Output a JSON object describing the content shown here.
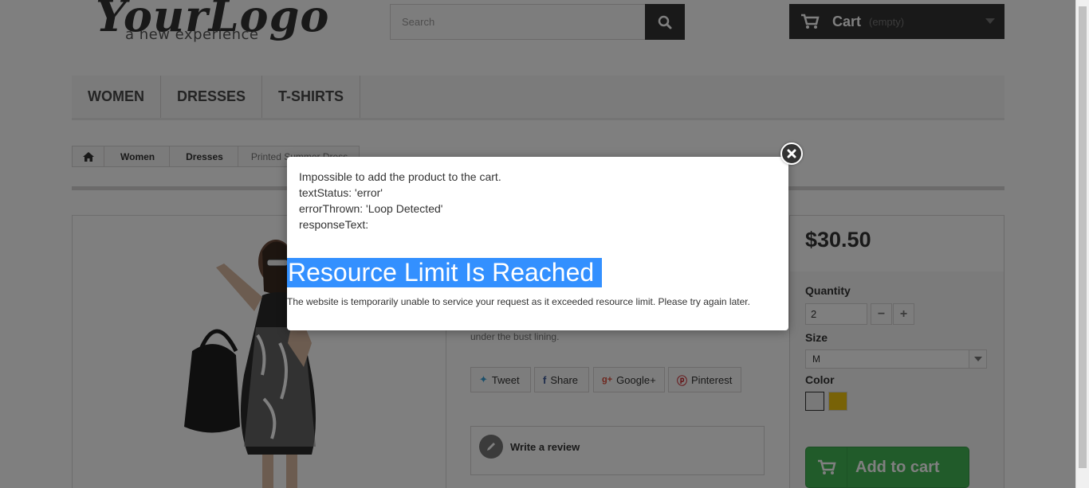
{
  "header": {
    "logo_script": "YourLogo",
    "logo_tagline": "a new experience",
    "search_placeholder": "Search",
    "cart_label": "Cart",
    "cart_status": "(empty)"
  },
  "menu": {
    "items": [
      "WOMEN",
      "DRESSES",
      "T-SHIRTS"
    ]
  },
  "breadcrumb": {
    "items": [
      "Women",
      "Dresses"
    ],
    "current": "Printed Summer Dress"
  },
  "product": {
    "description_tail": "under the bust lining.",
    "social": {
      "tweet": "Tweet",
      "share": "Share",
      "google": "Google+",
      "pinterest": "Pinterest"
    },
    "review_label": "Write a review"
  },
  "buy_box": {
    "price": "$30.50",
    "quantity_label": "Quantity",
    "quantity_value": "2",
    "minus": "−",
    "plus": "+",
    "size_label": "Size",
    "size_value": "M",
    "color_label": "Color",
    "colors": [
      "#f3f3f3",
      "#f1c40f"
    ],
    "add_to_cart": "Add to cart"
  },
  "modal": {
    "line1": "Impossible to add the product to the cart.",
    "line2": "textStatus: 'error'",
    "line3": "errorThrown: 'Loop Detected'",
    "line4": "responseText:",
    "heading": "Resource Limit Is Reached",
    "message": "The website is temporarily unable to service your request as it exceeded resource limit. Please try again later."
  }
}
